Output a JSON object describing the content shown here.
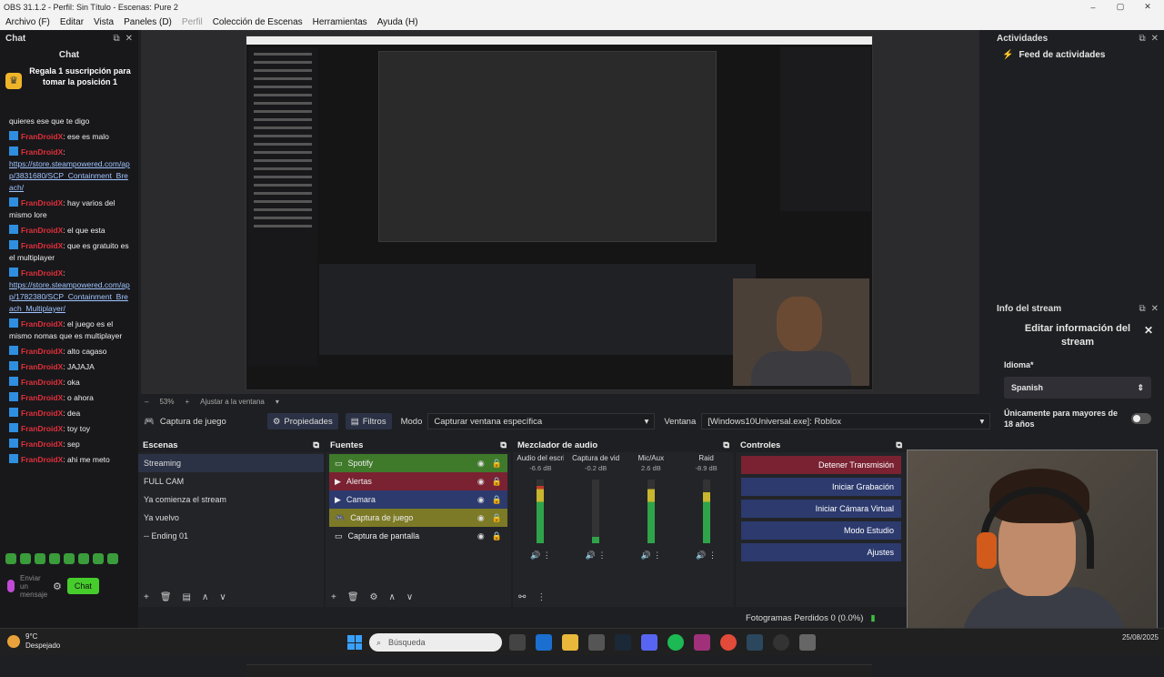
{
  "window": {
    "title": "OBS 31.1.2 - Perfil: Sin Título - Escenas: Pure 2"
  },
  "menu": [
    "Archivo (F)",
    "Editar",
    "Vista",
    "Paneles (D)",
    "Perfil",
    "Colección de Escenas",
    "Herramientas",
    "Ayuda (H)"
  ],
  "chat": {
    "dock_title": "Chat",
    "title": "Chat",
    "promo": "Regala 1 suscripción para tomar la posición 1",
    "messages": [
      {
        "user": "",
        "text": "quieres ese que te digo"
      },
      {
        "user": "FranDroidX",
        "text": ": ese es malo"
      },
      {
        "user": "FranDroidX",
        "text": ":",
        "link": "https://store.steampowered.com/app/3831680/SCP_Containment_Breach/"
      },
      {
        "user": "FranDroidX",
        "text": ": hay varios del mismo lore"
      },
      {
        "user": "FranDroidX",
        "text": ": el que esta"
      },
      {
        "user": "FranDroidX",
        "text": ": que es gratuito es el multiplayer"
      },
      {
        "user": "FranDroidX",
        "text": ":",
        "link": "https://store.steampowered.com/app/1782380/SCP_Containment_Breach_Multiplayer/"
      },
      {
        "user": "FranDroidX",
        "text": ": el juego es el mismo nomas que es multiplayer"
      },
      {
        "user": "FranDroidX",
        "text": ": alto cagaso"
      },
      {
        "user": "FranDroidX",
        "text": ": JAJAJA"
      },
      {
        "user": "FranDroidX",
        "text": ": oka"
      },
      {
        "user": "FranDroidX",
        "text": ": o ahora"
      },
      {
        "user": "FranDroidX",
        "text": ": dea"
      },
      {
        "user": "FranDroidX",
        "text": ": toy toy"
      },
      {
        "user": "FranDroidX",
        "text": ": sep"
      },
      {
        "user": "FranDroidX",
        "text": ": ahi me meto"
      }
    ],
    "input_placeholder": "Enviar un mensaje",
    "send_label": "Chat"
  },
  "zoom": {
    "level": "53%",
    "fit": "Ajustar a la ventana"
  },
  "source_toolbar": {
    "source_name": "Captura de juego",
    "properties": "Propiedades",
    "filters": "Filtros",
    "mode_label": "Modo",
    "mode_value": "Capturar ventana específica",
    "window_label": "Ventana",
    "window_value": "[Windows10Universal.exe]: Roblox"
  },
  "scenes": {
    "title": "Escenas",
    "items": [
      "Streaming",
      "FULL CAM",
      "Ya comienza el stream",
      "Ya vuelvo",
      "-- Ending 01"
    ]
  },
  "sources": {
    "title": "Fuentes",
    "items": [
      {
        "name": "Spotify",
        "color": "#3f7a2b"
      },
      {
        "name": "Alertas",
        "color": "#7a2232"
      },
      {
        "name": "Camara",
        "color": "#2c3a6e"
      },
      {
        "name": "Captura de juego",
        "color": "#7c7a26"
      },
      {
        "name": "Captura de pantalla",
        "color": ""
      }
    ]
  },
  "mixer": {
    "title": "Mezclador de audio",
    "channels": [
      {
        "name": "Audio del escritorio",
        "db": "-6.6 dB",
        "level": 0.9
      },
      {
        "name": "Captura de video",
        "db": "-0.2 dB",
        "level": 0.1
      },
      {
        "name": "Mic/Aux",
        "db": "2.6 dB",
        "level": 0.85
      },
      {
        "name": "Raid",
        "db": "-8.9 dB",
        "level": 0.8
      }
    ]
  },
  "controls": {
    "title": "Controles",
    "buttons": [
      "Detener Transmisión",
      "Iniciar Grabación",
      "Iniciar Cámara Virtual",
      "Modo Estudio",
      "Ajustes"
    ]
  },
  "actividades": {
    "title": "Actividades",
    "feed": "Feed de actividades"
  },
  "info_stream": {
    "title": "Info del stream",
    "heading": "Editar información del stream",
    "idioma_label": "Idioma*",
    "idioma_value": "Spanish",
    "mature_label": "Únicamente para mayores de 18 años"
  },
  "status": {
    "frames_dropped": "Fotogramas Perdidos 0 (0.0%)"
  },
  "taskbar": {
    "weather_temp": "9°C",
    "weather_desc": "Despejado",
    "search_placeholder": "Búsqueda",
    "date": "25/08/2025"
  }
}
